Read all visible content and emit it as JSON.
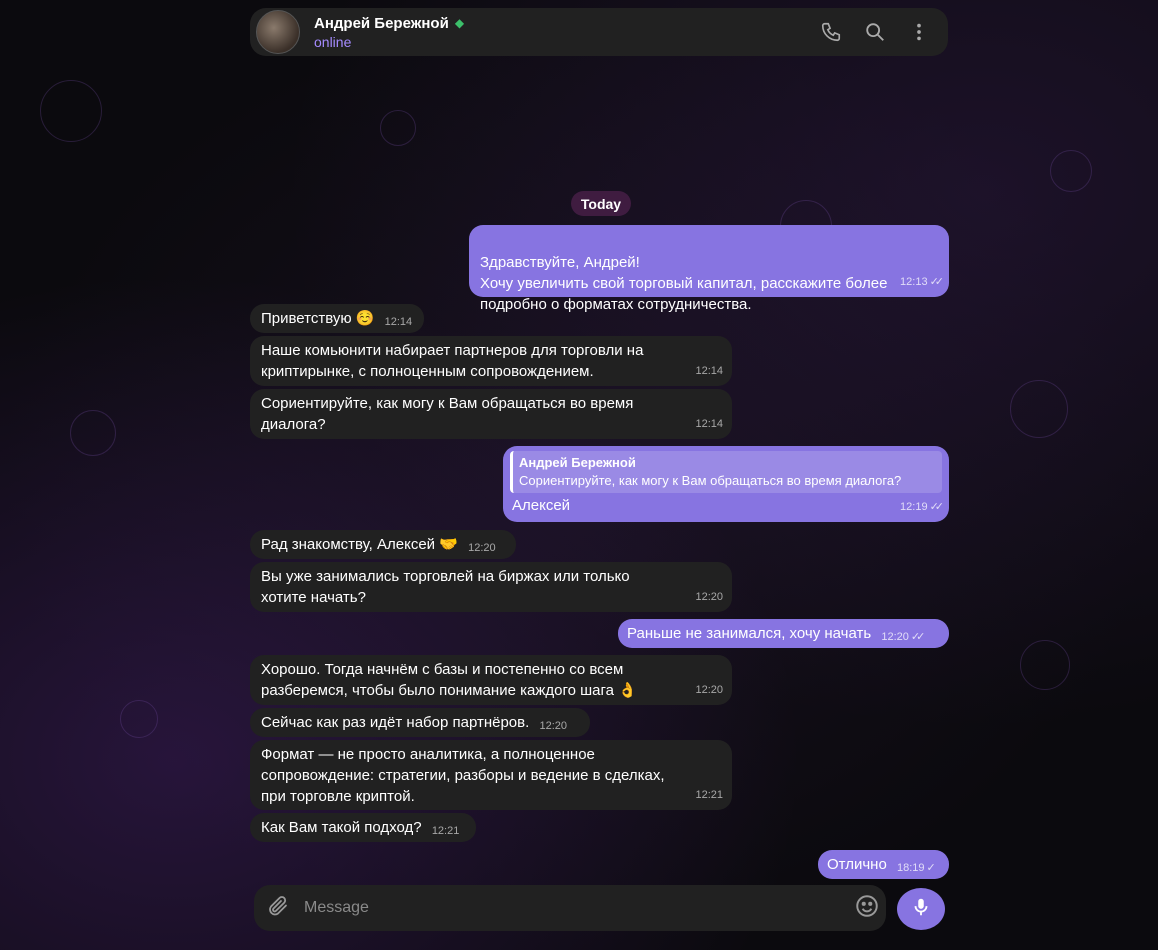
{
  "header": {
    "contact_name": "Андрей Бережной",
    "status": "online",
    "icons": [
      "phone-icon",
      "search-icon",
      "more-vertical-icon"
    ]
  },
  "date_separator": "Today",
  "messages": [
    {
      "dir": "out",
      "lines": "Здравствуйте, Андрей!\nХочу увеличить свой торговый капитал, расскажите более подробно о форматах сотрудничества.",
      "time": "12:13",
      "status": "read"
    },
    {
      "dir": "in",
      "text": "Приветствую ☺️",
      "time": "12:14"
    },
    {
      "dir": "in",
      "text": "Наше комьюнити набирает партнеров для торговли на криптирынке, с полноценным сопровождением.",
      "time": "12:14"
    },
    {
      "dir": "in",
      "text": "Сориентируйте, как могу к Вам обращаться во время диалога?",
      "time": "12:14"
    },
    {
      "dir": "out",
      "reply_name": "Андрей Бережной",
      "reply_text": "Сориентируйте, как могу к Вам обращаться во время диалога?",
      "text": "Алексей",
      "time": "12:19",
      "status": "read"
    },
    {
      "dir": "in",
      "text": "Рад знакомству, Алексей 🤝",
      "time": "12:20"
    },
    {
      "dir": "in",
      "text": "Вы уже занимались торговлей на биржах или только хотите начать?",
      "time": "12:20"
    },
    {
      "dir": "out",
      "text": "Раньше не занимался, хочу начать",
      "time": "12:20",
      "status": "read"
    },
    {
      "dir": "in",
      "text": "Хорошо. Тогда начнём с базы и постепенно со всем разберемся, чтобы было понимание каждого шага 👌",
      "time": "12:20"
    },
    {
      "dir": "in",
      "text": "Сейчас как раз идёт набор партнёров.",
      "time": "12:20"
    },
    {
      "dir": "in",
      "text": "Формат — не просто аналитика, а полноценное сопровождение: стратегии, разборы и ведение в сделках, при торговле криптой.",
      "time": "12:21"
    },
    {
      "dir": "in",
      "text": "Как Вам такой подход?",
      "time": "12:21"
    },
    {
      "dir": "out",
      "text": "Отлично",
      "time": "18:19",
      "status": "sent"
    }
  ],
  "composer": {
    "placeholder": "Message"
  },
  "colors": {
    "accent": "#8774e1",
    "incoming_bubble": "#212121",
    "status_online": "#a58bff"
  }
}
